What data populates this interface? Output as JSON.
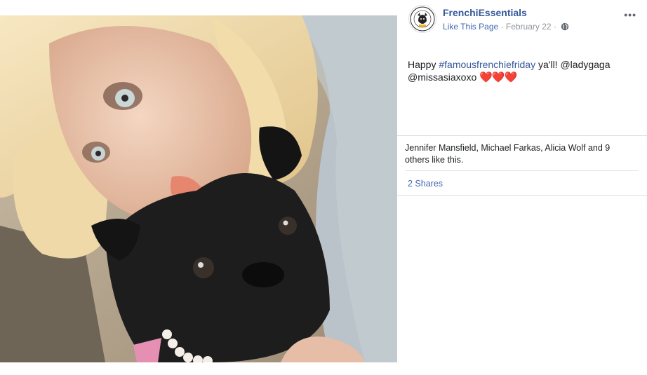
{
  "post": {
    "page_name": "FrenchiEssentials",
    "like_link": "Like This Page",
    "separator": "·",
    "date": "February 22",
    "privacy_icon": "globe-icon",
    "more_icon": "ellipsis-icon",
    "more_label": "•••",
    "message": {
      "prefix": "Happy ",
      "hashtag": "#famousfrenchiefriday",
      "rest": " ya'll! @ladygaga @missasiaxoxo",
      "hearts": "❤️❤️❤️"
    },
    "likes_summary": "Jennifer Mansfield, Michael Farkas, Alicia Wolf and 9 others like this.",
    "shares": "2 Shares",
    "avatar": {
      "text": "FRENCHI ESSENTIALS"
    },
    "photo": {
      "description_icon": "photo"
    }
  },
  "colors": {
    "link": "#365899",
    "action_link": "#4267b2",
    "meta_text": "#90949c",
    "divider": "#dddfe2",
    "heart": "#e0242f"
  }
}
